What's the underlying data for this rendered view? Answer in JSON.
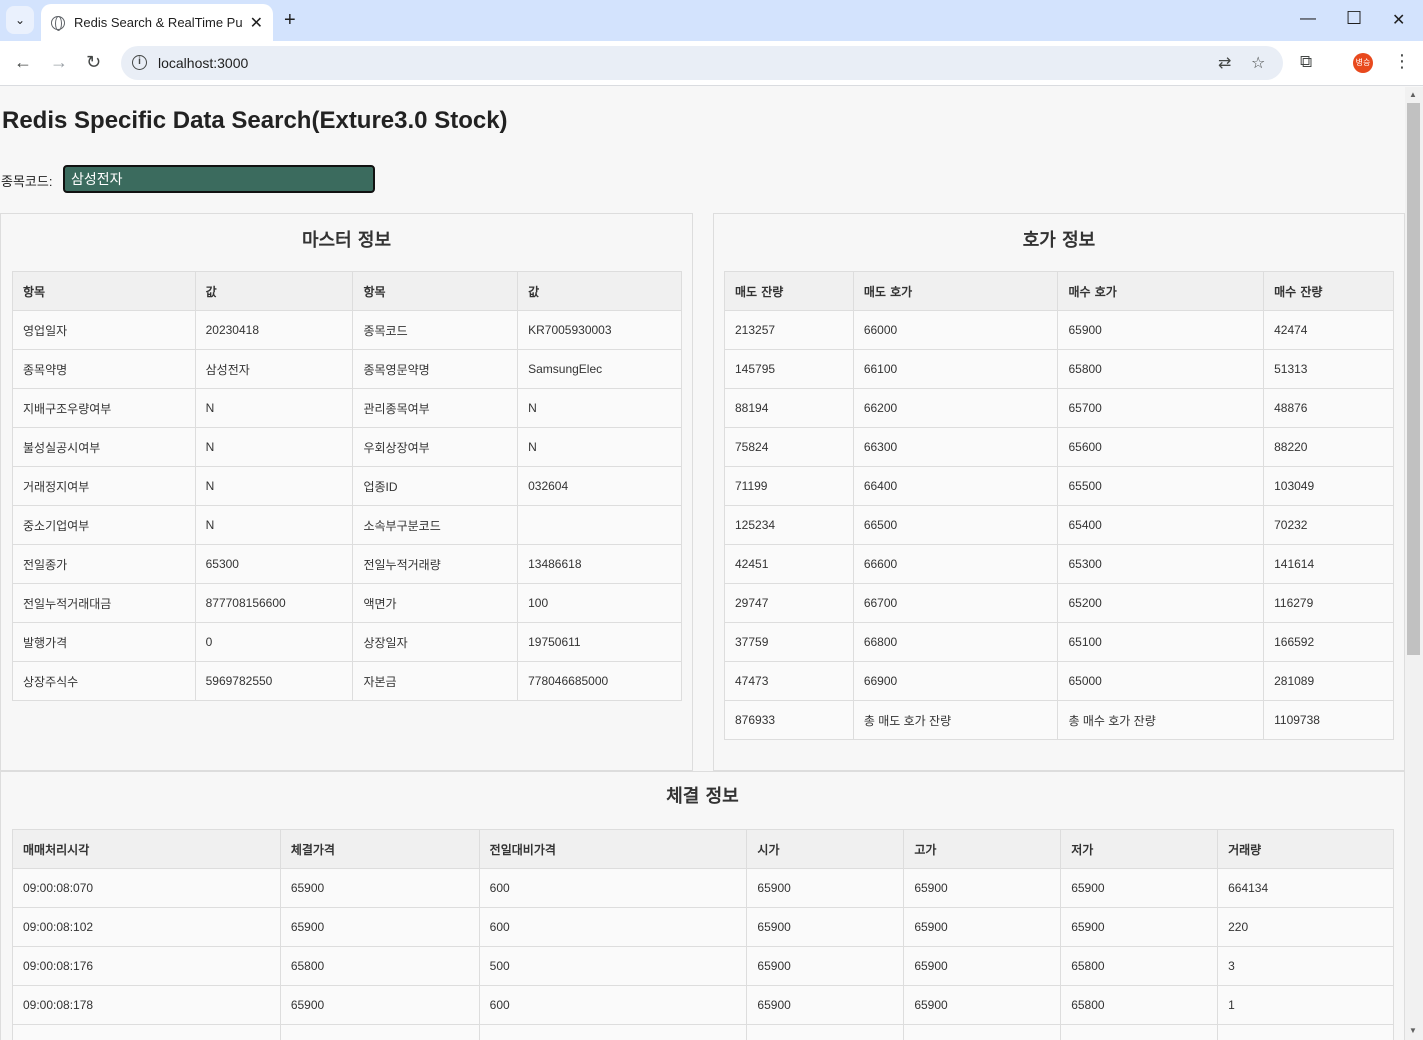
{
  "browser": {
    "tab_title": "Redis Search & RealTime Push",
    "url": "localhost:3000",
    "profile_initials": "병승"
  },
  "page": {
    "title": "Redis Specific Data Search(Exture3.0 Stock)",
    "search_label": "종목코드:",
    "search_value": "삼성전자"
  },
  "master": {
    "heading": "마스터 정보",
    "headers": [
      "항목",
      "값",
      "항목",
      "값"
    ],
    "rows": [
      [
        "영업일자",
        "20230418",
        "종목코드",
        "KR7005930003"
      ],
      [
        "종목약명",
        "삼성전자",
        "종목영문약명",
        "SamsungElec"
      ],
      [
        "지배구조우량여부",
        "N",
        "관리종목여부",
        "N"
      ],
      [
        "불성실공시여부",
        "N",
        "우회상장여부",
        "N"
      ],
      [
        "거래정지여부",
        "N",
        "업종ID",
        "032604"
      ],
      [
        "중소기업여부",
        "N",
        "소속부구분코드",
        ""
      ],
      [
        "전일종가",
        "65300",
        "전일누적거래량",
        "13486618"
      ],
      [
        "전일누적거래대금",
        "877708156600",
        "액면가",
        "100"
      ],
      [
        "발행가격",
        "0",
        "상장일자",
        "19750611"
      ],
      [
        "상장주식수",
        "5969782550",
        "자본금",
        "778046685000"
      ]
    ]
  },
  "quote": {
    "heading": "호가 정보",
    "headers": [
      "매도 잔량",
      "매도 호가",
      "매수 호가",
      "매수 잔량"
    ],
    "rows": [
      [
        "213257",
        "66000",
        "65900",
        "42474"
      ],
      [
        "145795",
        "66100",
        "65800",
        "51313"
      ],
      [
        "88194",
        "66200",
        "65700",
        "48876"
      ],
      [
        "75824",
        "66300",
        "65600",
        "88220"
      ],
      [
        "71199",
        "66400",
        "65500",
        "103049"
      ],
      [
        "125234",
        "66500",
        "65400",
        "70232"
      ],
      [
        "42451",
        "66600",
        "65300",
        "141614"
      ],
      [
        "29747",
        "66700",
        "65200",
        "116279"
      ],
      [
        "37759",
        "66800",
        "65100",
        "166592"
      ],
      [
        "47473",
        "66900",
        "65000",
        "281089"
      ],
      [
        "876933",
        "총 매도 호가 잔량",
        "총 매수 호가 잔량",
        "1109738"
      ]
    ]
  },
  "trade": {
    "heading": "체결 정보",
    "headers": [
      "매매처리시각",
      "체결가격",
      "전일대비가격",
      "시가",
      "고가",
      "저가",
      "거래량"
    ],
    "rows": [
      [
        "09:00:08:070",
        "65900",
        "600",
        "65900",
        "65900",
        "65900",
        "664134"
      ],
      [
        "09:00:08:102",
        "65900",
        "600",
        "65900",
        "65900",
        "65900",
        "220"
      ],
      [
        "09:00:08:176",
        "65800",
        "500",
        "65900",
        "65900",
        "65800",
        "3"
      ],
      [
        "09:00:08:178",
        "65900",
        "600",
        "65900",
        "65900",
        "65800",
        "1"
      ],
      [
        "",
        "",
        "",
        "",
        "",
        "",
        ""
      ]
    ]
  }
}
